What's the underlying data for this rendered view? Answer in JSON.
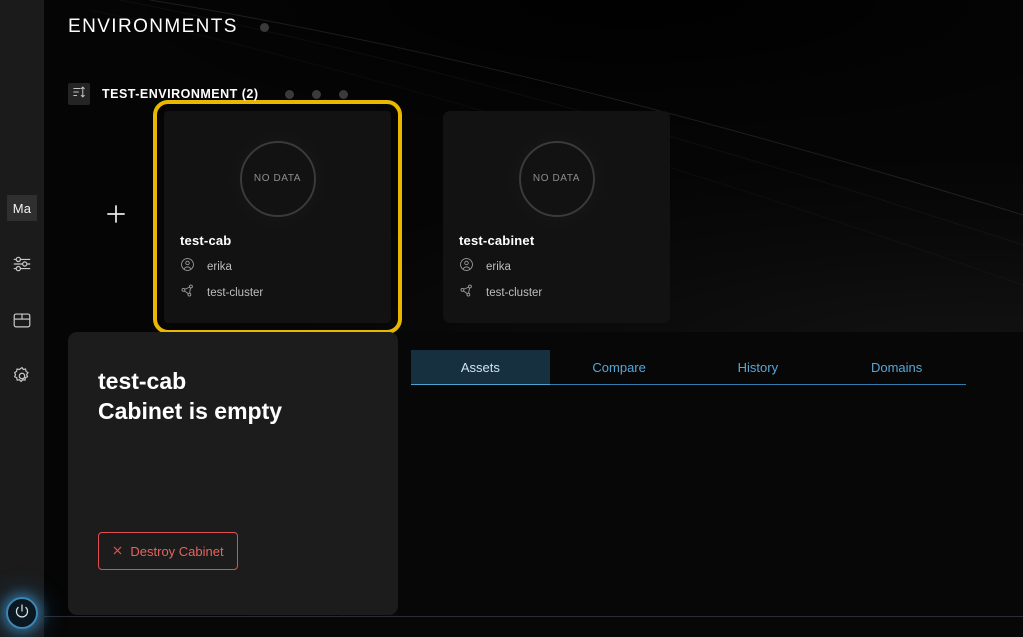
{
  "header": {
    "title": "ENVIRONMENTS",
    "status_dot": "status-dot"
  },
  "group": {
    "sort_icon": "sort-icon",
    "label": "TEST-ENVIRONMENT (2)",
    "dots": [
      "dot-1",
      "dot-2",
      "dot-3"
    ]
  },
  "cards_area": {
    "add_label": "+",
    "cards": [
      {
        "gauge_text": "NO DATA",
        "title": "test-cab",
        "owner_icon": "user-icon",
        "owner": "erika",
        "cluster_icon": "share-nodes-icon",
        "cluster": "test-cluster",
        "selected": true
      },
      {
        "gauge_text": "NO DATA",
        "title": "test-cabinet",
        "owner_icon": "user-icon",
        "owner": "erika",
        "cluster_icon": "share-nodes-icon",
        "cluster": "test-cluster",
        "selected": false
      }
    ]
  },
  "detail": {
    "name": "test-cab",
    "status": "Cabinet is empty",
    "destroy_icon": "close-x-icon",
    "destroy_label": "Destroy Cabinet"
  },
  "tabs": [
    {
      "label": "Assets",
      "active": true
    },
    {
      "label": "Compare",
      "active": false
    },
    {
      "label": "History",
      "active": false
    },
    {
      "label": "Domains",
      "active": false
    }
  ],
  "sidebar": {
    "avatar_label": "Ma",
    "items": [
      {
        "icon": "sliders-icon",
        "name": "sliders"
      },
      {
        "icon": "box-icon",
        "name": "box"
      },
      {
        "icon": "gear-icon",
        "name": "gear"
      }
    ],
    "power_icon": "power-icon"
  },
  "colors": {
    "accent_yellow": "#e8b800",
    "tab_blue": "#55a7d8",
    "tab_active_bg": "#16303f",
    "danger_red": "#e04f4f",
    "panel_bg": "#1c1c1c",
    "card_bg": "#121212",
    "sidebar_bg": "#1b1b1b"
  }
}
